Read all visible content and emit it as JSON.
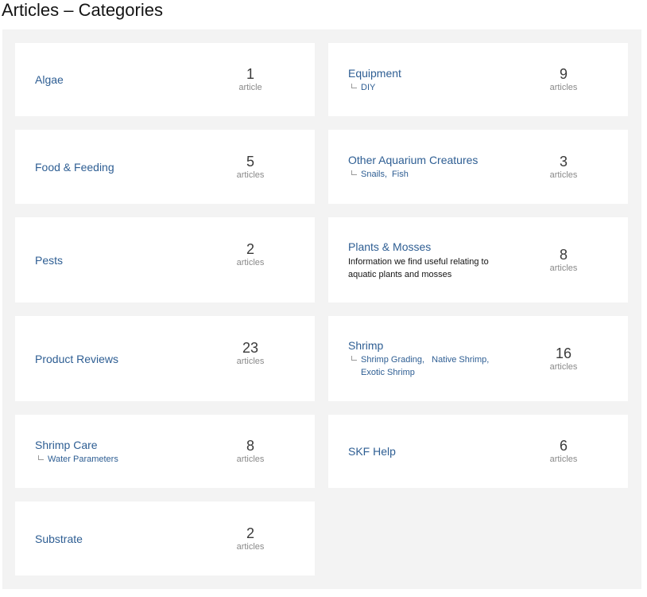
{
  "page": {
    "title": "Articles – Categories"
  },
  "categories": [
    {
      "name": "Algae",
      "count": "1",
      "unit": "article",
      "subs": [],
      "desc": ""
    },
    {
      "name": "Equipment",
      "count": "9",
      "unit": "articles",
      "subs": [
        "DIY"
      ],
      "desc": ""
    },
    {
      "name": "Food & Feeding",
      "count": "5",
      "unit": "articles",
      "subs": [],
      "desc": ""
    },
    {
      "name": "Other Aquarium Creatures",
      "count": "3",
      "unit": "articles",
      "subs": [
        "Snails",
        "Fish"
      ],
      "desc": ""
    },
    {
      "name": "Pests",
      "count": "2",
      "unit": "articles",
      "subs": [],
      "desc": ""
    },
    {
      "name": "Plants & Mosses",
      "count": "8",
      "unit": "articles",
      "subs": [],
      "desc": "Information we find useful relating to aquatic plants and mosses"
    },
    {
      "name": "Product Reviews",
      "count": "23",
      "unit": "articles",
      "subs": [],
      "desc": ""
    },
    {
      "name": "Shrimp",
      "count": "16",
      "unit": "articles",
      "subs": [
        "Shrimp Grading",
        "Native Shrimp",
        "Exotic Shrimp"
      ],
      "desc": ""
    },
    {
      "name": "Shrimp Care",
      "count": "8",
      "unit": "articles",
      "subs": [
        "Water Parameters"
      ],
      "desc": ""
    },
    {
      "name": "SKF Help",
      "count": "6",
      "unit": "articles",
      "subs": [],
      "desc": ""
    },
    {
      "name": "Substrate",
      "count": "2",
      "unit": "articles",
      "subs": [],
      "desc": ""
    }
  ]
}
